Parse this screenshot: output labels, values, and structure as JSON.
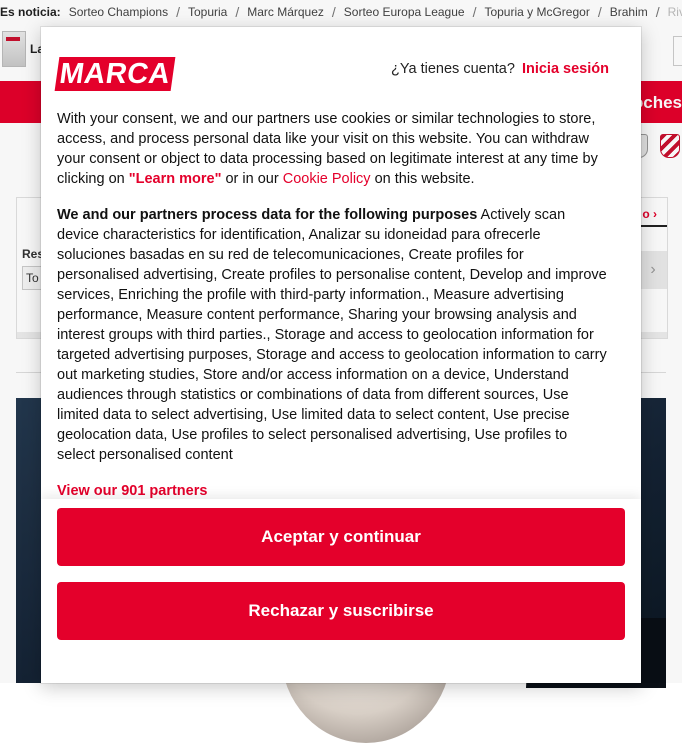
{
  "newsbar": {
    "lead": "Es noticia:",
    "links": [
      "Sorteo Champions",
      "Topuria",
      "Marc Márquez",
      "Sorteo Europa League",
      "Topuria y McGregor",
      "Brahim",
      "Rival R"
    ]
  },
  "header": {
    "text": "La"
  },
  "redbar": {
    "text": "oches"
  },
  "widget": {
    "label": "Res",
    "select_value": "To",
    "more_link": "o"
  },
  "modal": {
    "logo": "MARCA",
    "account_question": "¿Ya tienes cuenta?",
    "signin": "Inicia sesión",
    "intro_part1": "With your consent, we and our partners use cookies or similar technologies to store, access, and process personal data like your visit on this website. You can withdraw your consent or object to data processing based on legitimate interest at any time by clicking on ",
    "learn_more": "\"Learn more\"",
    "intro_part2": " or in our ",
    "cookie_policy": "Cookie Policy",
    "intro_part3": " on this website.",
    "purposes_heading": "We and our partners process data for the following purposes",
    "purposes_text": "Actively scan device characteristics for identification, Analizar su idoneidad para ofrecerle soluciones basadas en su red de telecomunicaciones, Create profiles for personalised advertising, Create profiles to personalise content, Develop and improve services, Enriching the profile with third-party information., Measure advertising performance, Measure content performance, Sharing your browsing analysis and interest groups with third parties., Storage and access to geolocation information for targeted advertising purposes, Storage and access to geolocation information to carry out marketing studies, Store and/or access information on a device, Understand audiences through statistics or combinations of data from different sources, Use limited data to select advertising, Use limited data to select content, Use precise geolocation data, Use profiles to select personalised advertising, Use profiles to select personalised content",
    "partners_link": "View our 901 partners",
    "accept_button": "Aceptar y continuar",
    "reject_button": "Rechazar y suscribirse"
  },
  "colors": {
    "brand_red": "#e4002b"
  }
}
